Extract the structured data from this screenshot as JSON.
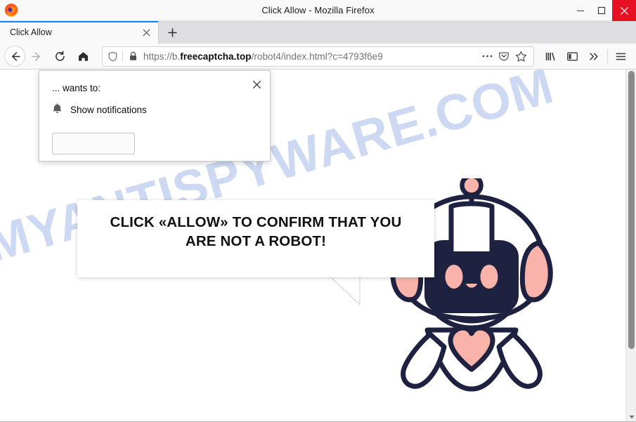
{
  "window": {
    "title": "Click Allow - Mozilla Firefox",
    "app_icon": "firefox-logo",
    "controls": {
      "minimize": "minimize-button",
      "maximize": "maximize-button",
      "close": "close-button",
      "close_color": "#e81123"
    }
  },
  "tabs": {
    "items": [
      {
        "title": "Click Allow",
        "active": true,
        "close_label": "close-tab"
      }
    ],
    "new_tab_label": "+",
    "active_indicator_color": "#0a84ff"
  },
  "toolbar": {
    "back": "back-button",
    "forward": "forward-button",
    "reload": "reload-button",
    "home": "home-button",
    "library": "library-button",
    "sidebar": "sidebar-button",
    "overflow": "overflow-button",
    "menu": "app-menu-button"
  },
  "urlbar": {
    "protocol": "https://",
    "subdomain": "b.",
    "host": "freecaptcha.top",
    "path": "/robot4/index.html?c=4793f6e9",
    "full_url": "https://b.freecaptcha.top/robot4/index.html?c=4793f6e9",
    "identity_icon": "shield-icon",
    "lock_icon": "lock-icon",
    "page_actions_icon": "ellipsis-icon",
    "pocket_icon": "pocket-icon",
    "bookmark_icon": "star-icon"
  },
  "notification_popup": {
    "heading": "... wants to:",
    "permission_icon": "bell-icon",
    "permission_label": "Show notifications",
    "primary_button_label": "",
    "close_label": "close-popup"
  },
  "page": {
    "speech_bubble": {
      "line1": "CLICK «ALLOW» TO CONFIRM THAT YOU",
      "line2": "ARE NOT A ROBOT!"
    },
    "watermark": "MYANTISPYWARE.COM",
    "watermark_color": "#cdd9f2",
    "robot": {
      "alt": "robot-mascot",
      "outline_color": "#1e2240",
      "accent_color": "#f9b3ab",
      "heart_color": "#f9b3ab",
      "visor_color": "#1e2240",
      "body_color": "#ffffff"
    },
    "background_color": "#ffffff"
  }
}
